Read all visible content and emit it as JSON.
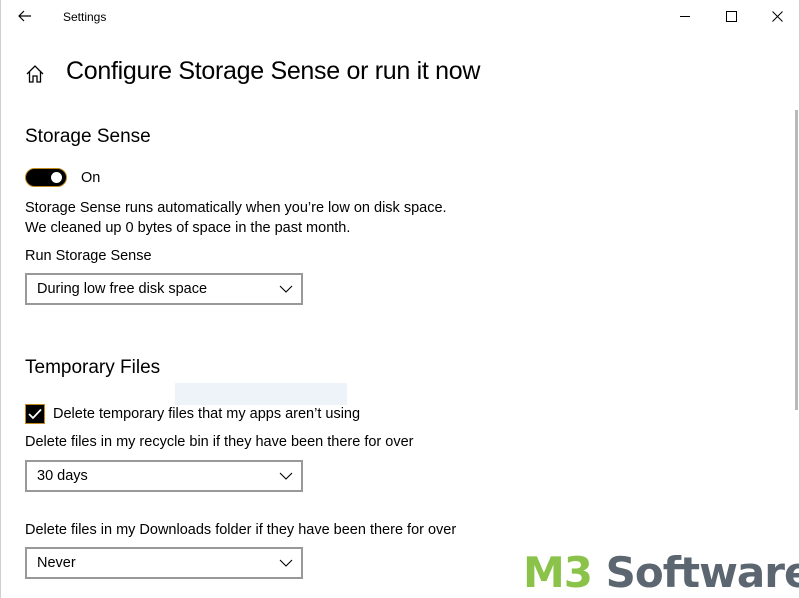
{
  "window": {
    "title": "Settings",
    "icons": {
      "back": "back-arrow-icon",
      "minimize": "minimize-icon",
      "maximize": "maximize-icon",
      "close": "close-icon",
      "home": "home-icon"
    }
  },
  "page": {
    "title": "Configure Storage Sense or run it now"
  },
  "storage_sense": {
    "section_title": "Storage Sense",
    "toggle_state": "On",
    "toggle_on": true,
    "description_line1": "Storage Sense runs automatically when you’re low on disk space.",
    "description_line2": "We cleaned up 0 bytes of space in the past month.",
    "run_label": "Run Storage Sense",
    "run_value": "During low free disk space"
  },
  "temporary_files": {
    "section_title": "Temporary Files",
    "delete_temp_label": "Delete temporary files that my apps aren’t using",
    "delete_temp_checked": true,
    "recycle_label": "Delete files in my recycle bin if they have been there for over",
    "recycle_value": "30 days",
    "downloads_label": "Delete files in my Downloads folder if they have been there for over",
    "downloads_value": "Never"
  },
  "watermark": {
    "brand_part1": "M3",
    "brand_part2": " Software"
  },
  "colors": {
    "accent_border": "#c08a1e",
    "logo_green": "#8bc34a",
    "logo_gray": "#5c6670"
  }
}
